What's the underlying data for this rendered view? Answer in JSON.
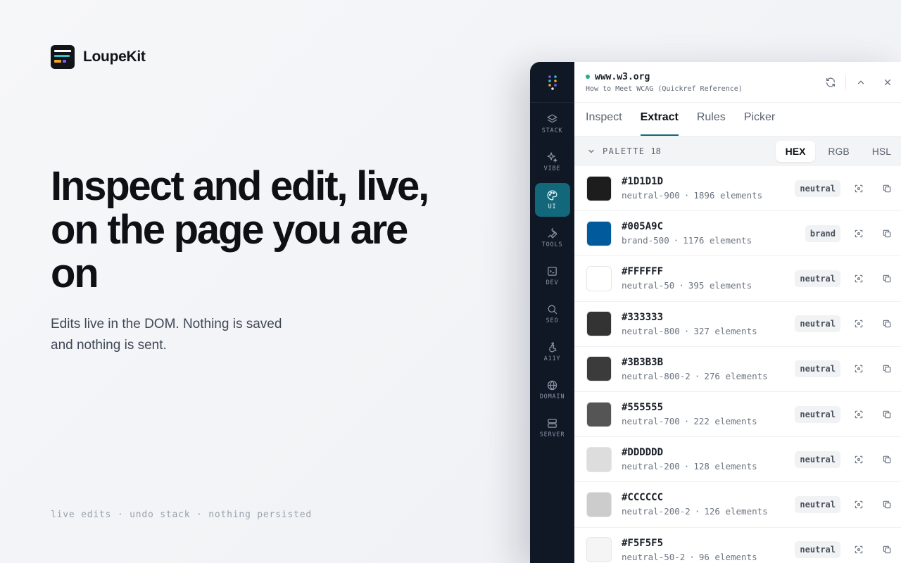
{
  "brand": {
    "name": "LoupeKit"
  },
  "hero": {
    "headline": "Inspect and edit, live, on the page you are on",
    "subline": "Edits live in the DOM. Nothing is saved and nothing is sent.",
    "footer": "live edits · undo stack · nothing persisted"
  },
  "rail": {
    "items": [
      {
        "label": "STACK",
        "icon": "layers-icon",
        "active": false
      },
      {
        "label": "VIBE",
        "icon": "sparkles-icon",
        "active": false
      },
      {
        "label": "UI",
        "icon": "palette-icon",
        "active": true
      },
      {
        "label": "TOOLS",
        "icon": "wrench-icon",
        "active": false
      },
      {
        "label": "DEV",
        "icon": "terminal-icon",
        "active": false
      },
      {
        "label": "SEO",
        "icon": "search-icon",
        "active": false
      },
      {
        "label": "A11Y",
        "icon": "accessibility-icon",
        "active": false
      },
      {
        "label": "DOMAIN",
        "icon": "globe-icon",
        "active": false
      },
      {
        "label": "SERVER",
        "icon": "server-icon",
        "active": false
      }
    ]
  },
  "site": {
    "host": "www.w3.org",
    "title": "How to Meet WCAG (Quickref Reference)",
    "status_color": "#22b07d"
  },
  "tabs": [
    {
      "label": "Inspect",
      "active": false
    },
    {
      "label": "Extract",
      "active": true
    },
    {
      "label": "Rules",
      "active": false
    },
    {
      "label": "Picker",
      "active": false
    }
  ],
  "palette": {
    "label": "PALETTE",
    "count": "18",
    "formats": [
      {
        "label": "HEX",
        "active": true
      },
      {
        "label": "RGB",
        "active": false
      },
      {
        "label": "HSL",
        "active": false
      }
    ],
    "colors": [
      {
        "hex": "#1D1D1D",
        "token": "neutral-900",
        "count": "1896 elements",
        "tag": "neutral"
      },
      {
        "hex": "#005A9C",
        "token": "brand-500",
        "count": "1176 elements",
        "tag": "brand"
      },
      {
        "hex": "#FFFFFF",
        "token": "neutral-50",
        "count": "395 elements",
        "tag": "neutral"
      },
      {
        "hex": "#333333",
        "token": "neutral-800",
        "count": "327 elements",
        "tag": "neutral"
      },
      {
        "hex": "#3B3B3B",
        "token": "neutral-800-2",
        "count": "276 elements",
        "tag": "neutral"
      },
      {
        "hex": "#555555",
        "token": "neutral-700",
        "count": "222 elements",
        "tag": "neutral"
      },
      {
        "hex": "#DDDDDD",
        "token": "neutral-200",
        "count": "128 elements",
        "tag": "neutral"
      },
      {
        "hex": "#CCCCCC",
        "token": "neutral-200-2",
        "count": "126 elements",
        "tag": "neutral"
      },
      {
        "hex": "#F5F5F5",
        "token": "neutral-50-2",
        "count": "96 elements",
        "tag": "neutral"
      }
    ]
  },
  "colors": {
    "accent": "#12677a",
    "rail_bg": "#101826"
  }
}
